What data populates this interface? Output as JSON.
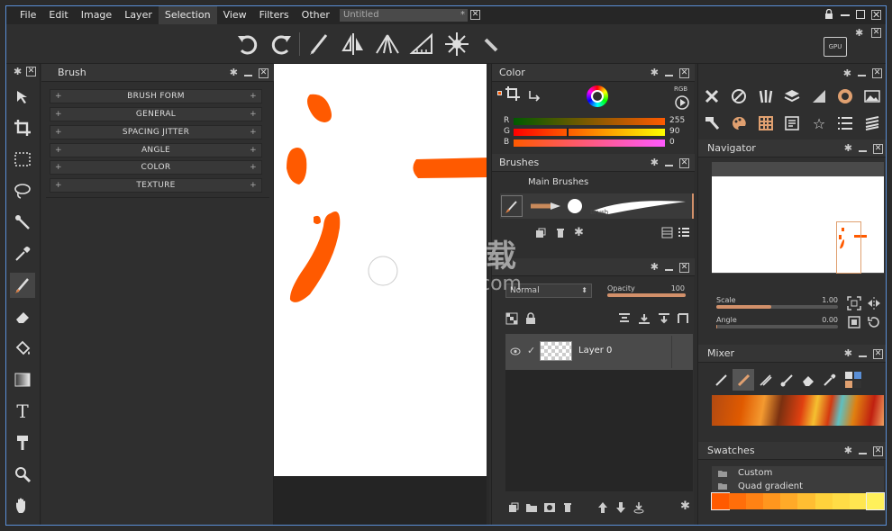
{
  "menubar": {
    "items": [
      "File",
      "Edit",
      "Image",
      "Layer",
      "Selection",
      "View",
      "Filters",
      "Other"
    ],
    "active": "Selection",
    "document_tab": "Untitled",
    "document_modified_mark": "*"
  },
  "brush_panel": {
    "title": "Brush",
    "sections": [
      "BRUSH FORM",
      "GENERAL",
      "SPACING JITTER",
      "ANGLE",
      "COLOR",
      "TEXTURE"
    ]
  },
  "color_panel": {
    "title": "Color",
    "mode": "RGB",
    "channels": [
      {
        "label": "R",
        "value": "255",
        "fraction": 1.0
      },
      {
        "label": "G",
        "value": "90",
        "fraction": 0.35
      },
      {
        "label": "B",
        "value": "0",
        "fraction": 0.0
      }
    ],
    "current_color": "#ff5a00"
  },
  "brushes_panel": {
    "title": "Brushes",
    "set_name": "Main Brushes",
    "stroke_label": "Brush"
  },
  "layers_panel": {
    "blend_mode": "Normal",
    "opacity_label": "Opacity",
    "opacity_value": "100",
    "layer_name": "Layer 0"
  },
  "navigator": {
    "title": "Navigator",
    "scale_label": "Scale",
    "scale_value": "1.00",
    "angle_label": "Angle",
    "angle_value": "0.00"
  },
  "mixer": {
    "title": "Mixer"
  },
  "swatches": {
    "title": "Swatches",
    "items": [
      "Custom",
      "Quad gradient"
    ],
    "gradient_colors": [
      "#ff5a00",
      "#ff6e0a",
      "#ff8214",
      "#ff961e",
      "#ffaa28",
      "#ffbe32",
      "#ffd23c",
      "#ffdc46",
      "#ffe650",
      "#fff05a"
    ]
  },
  "toolbar": {
    "gpu_label": "GPU"
  },
  "watermark": {
    "text": "安下载",
    "subtext": "anxz.com"
  }
}
